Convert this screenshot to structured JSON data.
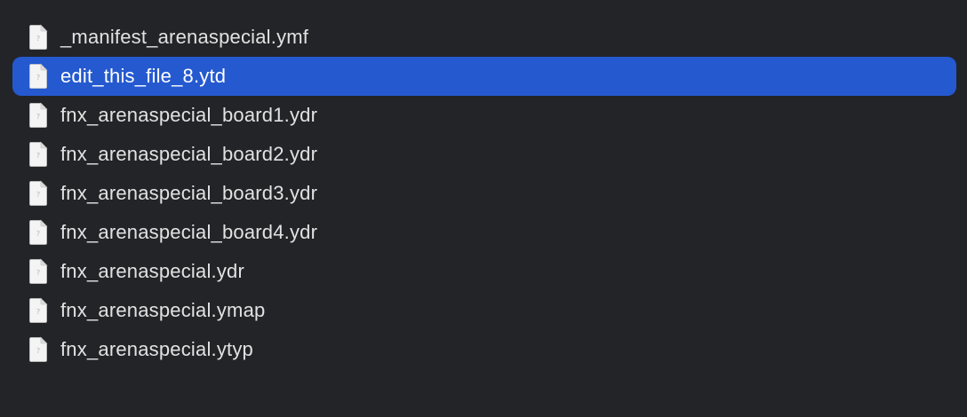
{
  "files": [
    {
      "name": "_manifest_arenaspecial.ymf",
      "icon": "generic-document-icon",
      "selected": false
    },
    {
      "name": "edit_this_file_8.ytd",
      "icon": "generic-document-icon",
      "selected": true
    },
    {
      "name": "fnx_arenaspecial_board1.ydr",
      "icon": "generic-document-icon",
      "selected": false
    },
    {
      "name": "fnx_arenaspecial_board2.ydr",
      "icon": "generic-document-icon",
      "selected": false
    },
    {
      "name": "fnx_arenaspecial_board3.ydr",
      "icon": "generic-document-icon",
      "selected": false
    },
    {
      "name": "fnx_arenaspecial_board4.ydr",
      "icon": "generic-document-icon",
      "selected": false
    },
    {
      "name": "fnx_arenaspecial.ydr",
      "icon": "generic-document-icon",
      "selected": false
    },
    {
      "name": "fnx_arenaspecial.ymap",
      "icon": "generic-document-icon",
      "selected": false
    },
    {
      "name": "fnx_arenaspecial.ytyp",
      "icon": "generic-document-icon",
      "selected": false
    }
  ],
  "colors": {
    "background": "#232427",
    "selection": "#2559cf",
    "text": "#e2e2e3",
    "selected_text": "#ffffff"
  }
}
